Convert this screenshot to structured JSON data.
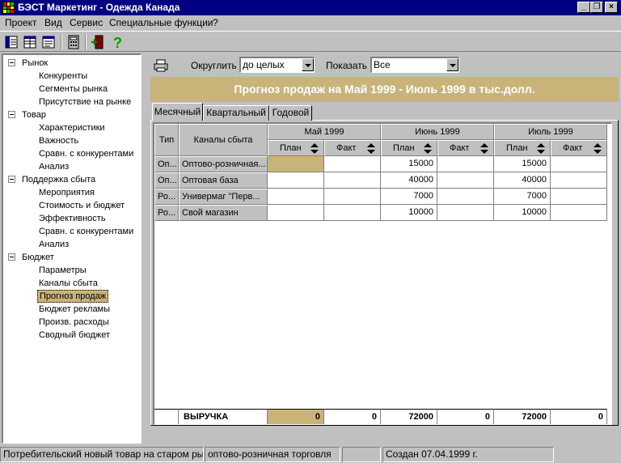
{
  "window": {
    "title": "БЭСТ Маркетинг - Одежда Канада",
    "minimize": "_",
    "restore": "❐",
    "close": "×"
  },
  "menu": [
    "Проект",
    "Вид",
    "Сервис",
    "Специальные функции",
    "?"
  ],
  "toolbar": {
    "icons": [
      "view-list-icon",
      "view-table-icon",
      "view-details-icon",
      "calculator-icon",
      "exit-icon",
      "help-icon"
    ],
    "help_glyph": "?"
  },
  "tree": {
    "groups": [
      {
        "label": "Рынок",
        "items": [
          "Конкуренты",
          "Сегменты рынка",
          "Присутствие на рынке"
        ]
      },
      {
        "label": "Товар",
        "items": [
          "Характеристики",
          "Важность",
          "Сравн. с конкурентами",
          "Анализ"
        ]
      },
      {
        "label": "Поддержка сбыта",
        "items": [
          "Мероприятия",
          "Стоимость и бюджет",
          "Эффективность",
          "Сравн. с конкурентами",
          "Анализ"
        ]
      },
      {
        "label": "Бюджет",
        "items": [
          "Параметры",
          "Каналы сбыта",
          "Прогноз продаж",
          "Бюджет рекламы",
          "Произв. расходы",
          "Сводный бюджет"
        ]
      }
    ],
    "selected": "Прогноз продаж"
  },
  "controls": {
    "round_label": "Округлить",
    "round_value": "до целых",
    "show_label": "Показать",
    "show_value": "Все"
  },
  "banner": "Прогноз продаж на Май 1999 - Июль 1999 в тыс.долл.",
  "tabs": [
    "Месячный",
    "Квартальный",
    "Годовой"
  ],
  "active_tab": "Месячный",
  "grid": {
    "col_type": "Тип",
    "col_channel": "Каналы сбыта",
    "months": [
      "Май 1999",
      "Июнь 1999",
      "Июль 1999"
    ],
    "plan": "План",
    "fact": "Факт",
    "rows": [
      {
        "type": "Оп...",
        "channel": "Оптово-розничная...",
        "values": [
          "",
          "",
          "15000",
          "",
          "15000",
          ""
        ]
      },
      {
        "type": "Оп...",
        "channel": "Оптовая база",
        "values": [
          "",
          "",
          "40000",
          "",
          "40000",
          ""
        ]
      },
      {
        "type": "Ро...",
        "channel": "Универмаг \"Перв...",
        "values": [
          "",
          "",
          "7000",
          "",
          "7000",
          ""
        ]
      },
      {
        "type": "Ро...",
        "channel": "Свой магазин",
        "values": [
          "",
          "",
          "10000",
          "",
          "10000",
          ""
        ]
      }
    ],
    "total_label": "ВЫРУЧКА",
    "totals": [
      "0",
      "0",
      "72000",
      "0",
      "72000",
      "0"
    ]
  },
  "status": [
    "Потребительский новый товар на старом рынке",
    "оптово-розничная торговля",
    "",
    "Создан 07.04.1999 г."
  ],
  "colors": {
    "title_bg": "#000080",
    "banner_bg": "#c8b478",
    "selected": "#c8b478",
    "face": "#c0c0c0"
  }
}
